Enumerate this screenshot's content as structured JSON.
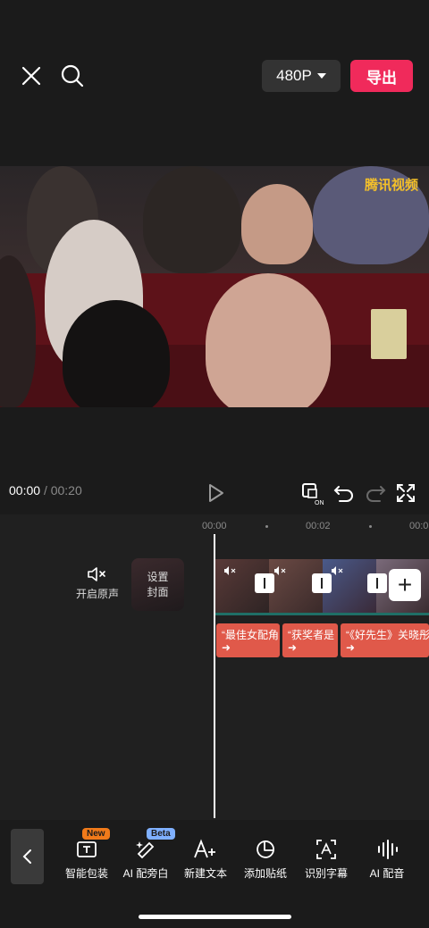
{
  "topbar": {
    "resolution": "480P",
    "export_label": "导出"
  },
  "video": {
    "watermark": "腾讯视频"
  },
  "playback": {
    "current_time": "00:00",
    "separator": "/",
    "duration": "00:20"
  },
  "timeline": {
    "ruler": [
      "00:00",
      "00:02",
      "00:0"
    ],
    "audio_toggle_label": "开启原声",
    "cover_label_line1": "设置",
    "cover_label_line2": "封面",
    "captions": [
      "“最佳女配角",
      "“获奖者是",
      "“《好先生》关晓彤"
    ]
  },
  "toolbar": {
    "items": [
      {
        "label": "智能包装",
        "badge": "New",
        "icon": "text-template-icon"
      },
      {
        "label": "AI 配旁白",
        "badge": "Beta",
        "icon": "magic-pen-icon"
      },
      {
        "label": "新建文本",
        "badge": "",
        "icon": "add-text-icon"
      },
      {
        "label": "添加贴纸",
        "badge": "",
        "icon": "sticker-icon"
      },
      {
        "label": "识别字幕",
        "badge": "",
        "icon": "caption-recognize-icon"
      },
      {
        "label": "AI 配音",
        "badge": "",
        "icon": "waveform-icon"
      }
    ]
  },
  "colors": {
    "accent": "#f02a5b",
    "caption_track": "#e0594a",
    "new_badge": "#f07a1a",
    "beta_badge": "#7fb0ff"
  }
}
